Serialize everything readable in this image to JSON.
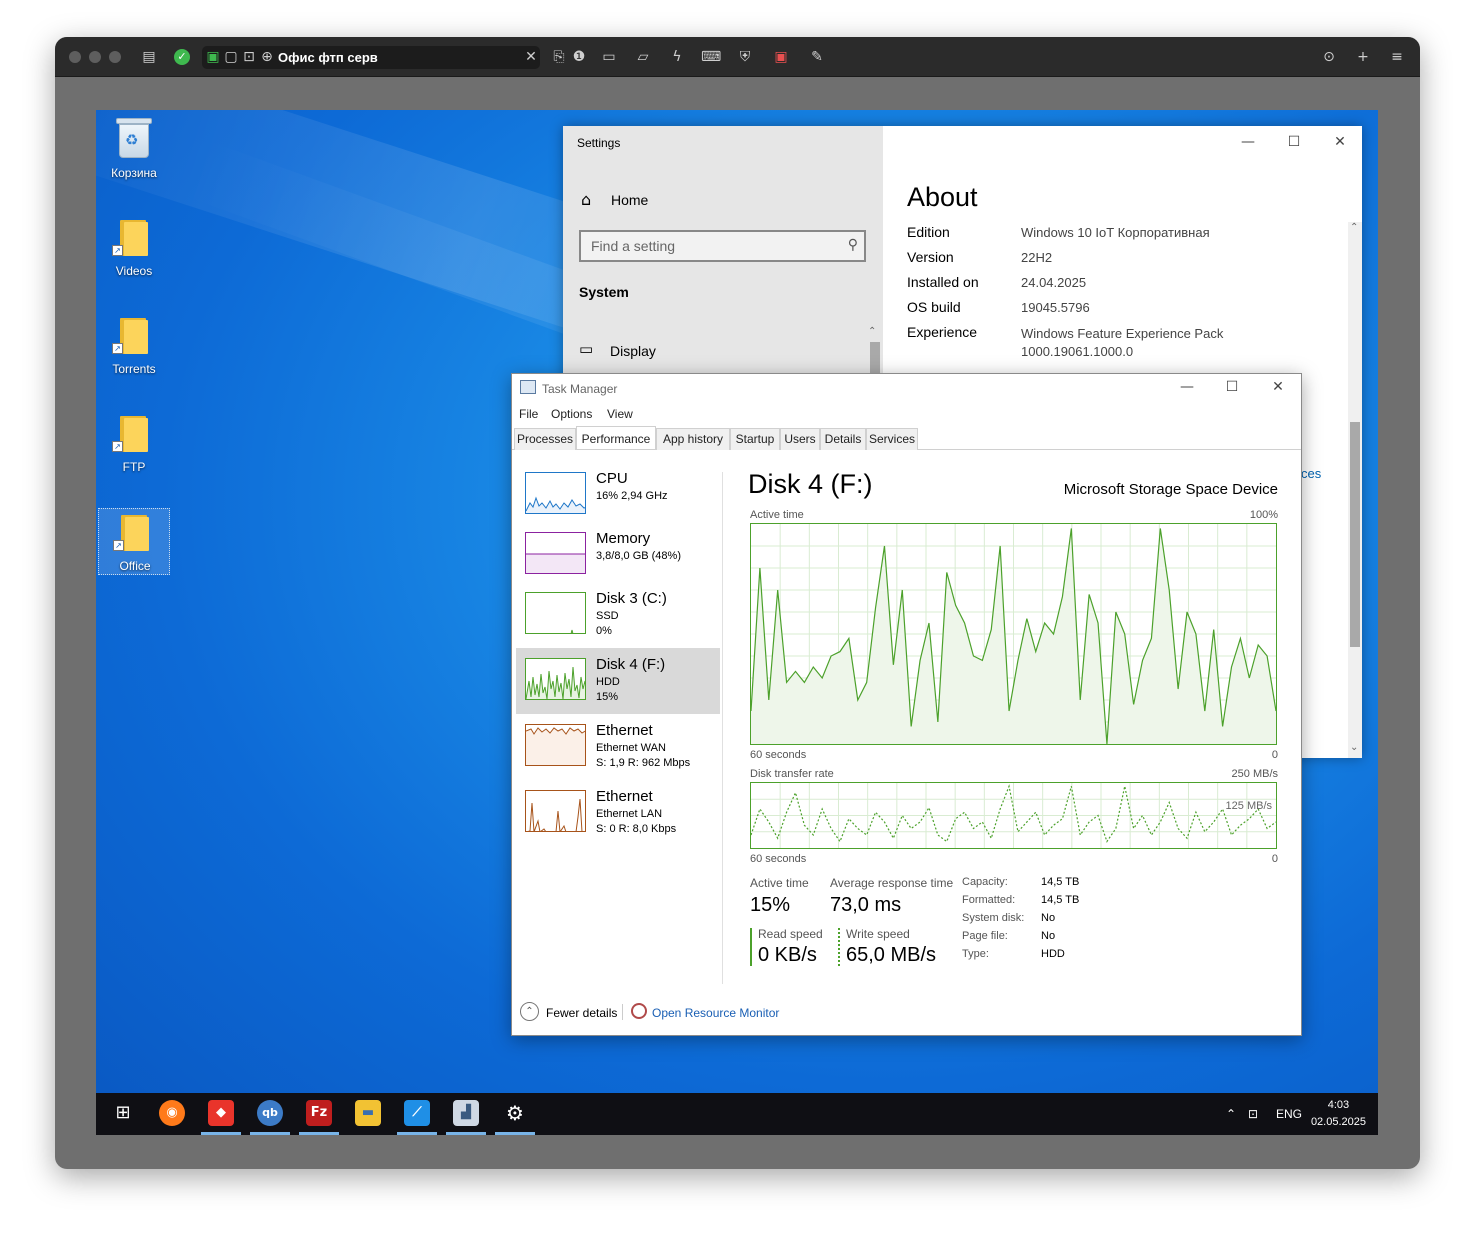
{
  "host_toolbar": {
    "session_title": "Офис фтп серв",
    "icons": [
      "download-icon",
      "plus-icon",
      "menu-icon"
    ]
  },
  "desktop": {
    "icons": [
      {
        "label": "Корзина",
        "type": "recycle-bin"
      },
      {
        "label": "Videos",
        "type": "folder"
      },
      {
        "label": "Torrents",
        "type": "folder"
      },
      {
        "label": "FTP",
        "type": "folder"
      },
      {
        "label": "Office",
        "type": "folder"
      }
    ]
  },
  "settings": {
    "title": "Settings",
    "home": "Home",
    "search_placeholder": "Find a setting",
    "section": "System",
    "nav_item": "Display",
    "heading": "About",
    "rows": [
      {
        "key": "Edition",
        "value": "Windows 10 IoT Корпоративная"
      },
      {
        "key": "Version",
        "value": "22H2"
      },
      {
        "key": "Installed on",
        "value": "24.04.2025"
      },
      {
        "key": "OS build",
        "value": "19045.5796"
      },
      {
        "key": "Experience",
        "value": "Windows Feature Experience Pack",
        "value2": "1000.19061.1000.0"
      }
    ],
    "partial_link": "ces"
  },
  "taskmanager": {
    "title": "Task Manager",
    "menu": [
      "File",
      "Options",
      "View"
    ],
    "tabs": [
      "Processes",
      "Performance",
      "App history",
      "Startup",
      "Users",
      "Details",
      "Services"
    ],
    "active_tab": "Performance",
    "resources": [
      {
        "name": "CPU",
        "sub1": "16% 2,94 GHz",
        "sub2": "",
        "color": "#1f77c8"
      },
      {
        "name": "Memory",
        "sub1": "3,8/8,0 GB (48%)",
        "sub2": "",
        "color": "#8b22a0"
      },
      {
        "name": "Disk 3 (C:)",
        "sub1": "SSD",
        "sub2": "0%",
        "color": "#4ca12b"
      },
      {
        "name": "Disk 4 (F:)",
        "sub1": "HDD",
        "sub2": "15%",
        "color": "#4ca12b"
      },
      {
        "name": "Ethernet",
        "sub1": "Ethernet WAN",
        "sub2": "S: 1,9 R: 962 Mbps",
        "color": "#a7531a"
      },
      {
        "name": "Ethernet",
        "sub1": "Ethernet LAN",
        "sub2": "S: 0 R: 8,0 Kbps",
        "color": "#a7531a"
      }
    ],
    "detail": {
      "title": "Disk 4 (F:)",
      "model": "Microsoft Storage Space Device",
      "active_label": "Active time",
      "active_max": "100%",
      "seconds_label": "60 seconds",
      "zero": "0",
      "transfer_label": "Disk transfer rate",
      "transfer_max": "250 MB/s",
      "transfer_mid": "125 MB/s",
      "active_time_label": "Active time",
      "active_time_value": "15%",
      "avg_resp_label": "Average response time",
      "avg_resp_value": "73,0 ms",
      "read_label": "Read speed",
      "read_value": "0 KB/s",
      "write_label": "Write speed",
      "write_value": "65,0 MB/s",
      "props": [
        {
          "k": "Capacity:",
          "v": "14,5 TB"
        },
        {
          "k": "Formatted:",
          "v": "14,5 TB"
        },
        {
          "k": "System disk:",
          "v": "No"
        },
        {
          "k": "Page file:",
          "v": "No"
        },
        {
          "k": "Type:",
          "v": "HDD"
        }
      ]
    },
    "footer": {
      "fewer": "Fewer details",
      "resmon": "Open Resource Monitor"
    }
  },
  "charts": {
    "active_time_series": [
      15,
      80,
      20,
      70,
      28,
      33,
      28,
      35,
      30,
      40,
      42,
      48,
      20,
      28,
      62,
      90,
      36,
      70,
      8,
      38,
      55,
      10,
      78,
      63,
      55,
      40,
      38,
      52,
      90,
      15,
      38,
      57,
      42,
      55,
      50,
      67,
      98,
      20,
      68,
      55,
      0,
      60,
      50,
      18,
      38,
      48,
      98,
      70,
      25,
      60,
      50,
      15,
      52,
      8,
      35,
      48,
      30,
      45,
      40,
      15
    ],
    "transfer_series": [
      20,
      60,
      40,
      15,
      55,
      85,
      35,
      20,
      60,
      30,
      10,
      45,
      30,
      20,
      55,
      40,
      15,
      50,
      30,
      40,
      62,
      20,
      10,
      45,
      55,
      30,
      40,
      15,
      60,
      95,
      25,
      40,
      55,
      20,
      35,
      45,
      95,
      20,
      40,
      50,
      10,
      30,
      95,
      30,
      50,
      20,
      40,
      70,
      30,
      15,
      55,
      25,
      40,
      60,
      20,
      35,
      45,
      60,
      30,
      40
    ]
  },
  "taskbar": {
    "apps": [
      "start-icon",
      "firefox-icon",
      "anydesk-icon",
      "qbittorrent-icon",
      "filezilla-icon",
      "explorer-icon",
      "app-icon",
      "taskmanager-icon",
      "settings-icon"
    ],
    "lang": "ENG",
    "time": "4:03",
    "date": "02.05.2025"
  }
}
